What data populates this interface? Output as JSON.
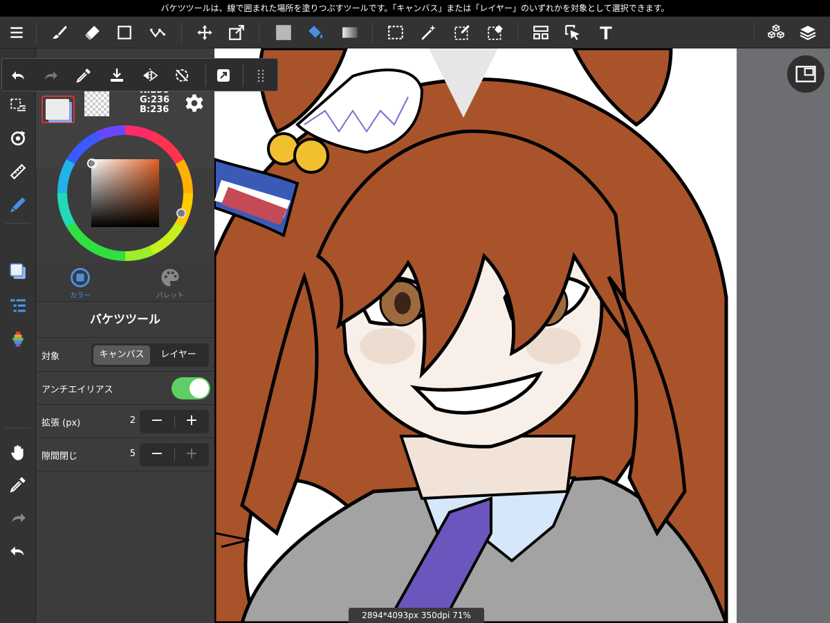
{
  "hint_bar": {
    "text": "バケツツールは、線で囲まれた場所を塗りつぶすツールです。「キャンバス」または「レイヤー」のいずれかを対象として選択できます。"
  },
  "toolbar": {
    "icons": [
      "menu-icon",
      "brush-icon",
      "eraser-icon",
      "shape-icon",
      "select-curve-icon",
      "move-icon",
      "transform-icon",
      "fill-color-icon",
      "bucket-icon",
      "gradient-icon",
      "selection-icon",
      "magic-wand-icon",
      "select-pen-icon",
      "select-eraser-icon",
      "panel-layout-icon",
      "operate-icon",
      "text-icon",
      "3d-material-icon",
      "layers-icon"
    ]
  },
  "quick_bar": {
    "icons": [
      "undo-icon",
      "redo-icon",
      "eyedropper-icon",
      "save-download-icon",
      "flip-icon",
      "rotate-reset-icon",
      "fullscreen-icon",
      "more-grid-icon"
    ]
  },
  "color_panel": {
    "main_color": "#ececec",
    "rgb_r": "R:236",
    "rgb_g": "G:236",
    "rgb_b": "B:236",
    "tab_color_label": "カラー",
    "tab_palette_label": "パレット"
  },
  "tool_props": {
    "title": "バケツツール",
    "target_label": "対象",
    "target_canvas": "キャンバス",
    "target_layer": "レイヤー",
    "target_selected": "キャンバス",
    "antialias_label": "アンチエイリアス",
    "antialias_on": true,
    "expand_label": "拡張 (px)",
    "expand_value": "2",
    "gap_label": "隙間閉じ",
    "gap_value": "5",
    "minus": "−",
    "plus": "+"
  },
  "status": {
    "text": "2894*4093px 350dpi 71%"
  },
  "colors": {
    "accent_blue": "#4a90e2",
    "toggle_green": "#5fcf64",
    "hair": "#a9532b",
    "panel": "#3c3c3c"
  }
}
